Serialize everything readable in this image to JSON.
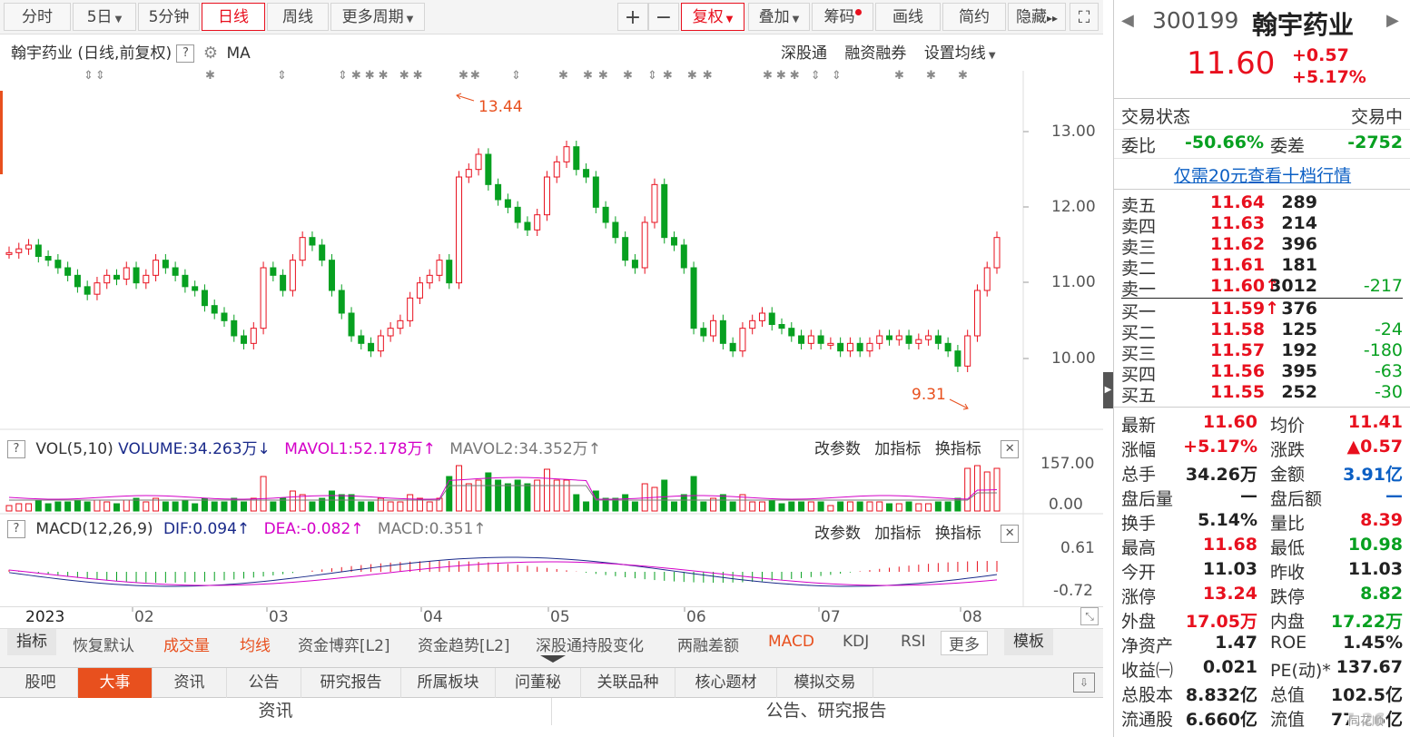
{
  "toolbar": {
    "periods": [
      "分时",
      "5日",
      "5分钟",
      "日线",
      "周线",
      "更多周期"
    ],
    "active_period": "日线",
    "tools": [
      "+",
      "−",
      "复权",
      "叠加",
      "筹码",
      "画线",
      "简约",
      "隐藏"
    ],
    "hide_arrow": "▸▸"
  },
  "main_chart": {
    "title": "翰宇药业 (日线,前复权)",
    "q": "?",
    "ma_label": "MA",
    "links": [
      "深股通",
      "融资融券",
      "设置均线"
    ],
    "y_ticks": [
      "13.00",
      "12.00",
      "11.00",
      "10.00"
    ],
    "high_label": "13.44",
    "low_label": "9.31"
  },
  "vol_panel": {
    "q": "?",
    "name": "VOL(5,10)",
    "volume": "VOLUME:34.263万",
    "volume_arrow": "↓",
    "mavol1": "MAVOL1:52.178万",
    "mavol1_arrow": "↑",
    "mavol2": "MAVOL2:34.352万",
    "mavol2_arrow": "↑",
    "actions": [
      "改参数",
      "加指标",
      "换指标"
    ],
    "close": "✕",
    "y_ticks": [
      "157.00",
      "0.00"
    ]
  },
  "macd_panel": {
    "q": "?",
    "name": "MACD(12,26,9)",
    "dif": "DIF:0.094",
    "dif_arrow": "↑",
    "dea": "DEA:-0.082",
    "dea_arrow": "↑",
    "macd": "MACD:0.351",
    "macd_arrow": "↑",
    "actions": [
      "改参数",
      "加指标",
      "换指标"
    ],
    "close": "✕",
    "y_ticks": [
      "0.61",
      "-0.72"
    ]
  },
  "date_axis": {
    "labels": [
      "2023",
      "02",
      "03",
      "04",
      "05",
      "06",
      "07",
      "08"
    ]
  },
  "indicator_bar": {
    "label": "指标",
    "items": [
      "恢复默认",
      "成交量",
      "均线",
      "资金博弈[L2]",
      "资金趋势[L2]",
      "深股通持股变化",
      "两融差额",
      "MACD",
      "KDJ",
      "RSI"
    ],
    "more": "更多",
    "template": "模板"
  },
  "bottom_tabs": {
    "items": [
      "股吧",
      "大事",
      "资讯",
      "公告",
      "研究报告",
      "所属板块",
      "问董秘",
      "关联品种",
      "核心题材",
      "模拟交易"
    ],
    "active": "大事"
  },
  "news_headers": [
    "资讯",
    "公告、研究报告"
  ],
  "quote": {
    "code": "300199",
    "name": "翰宇药业",
    "price": "11.60",
    "change": "+0.57",
    "change_pct": "+5.17%",
    "status_label": "交易状态",
    "status_value": "交易中",
    "weibi_label": "委比",
    "weibi": "-50.66%",
    "weicha_label": "委差",
    "weicha": "-2752",
    "promo": "仅需20元查看十档行情",
    "asks": [
      {
        "label": "卖五",
        "price": "11.64",
        "vol": "289",
        "chg": ""
      },
      {
        "label": "卖四",
        "price": "11.63",
        "vol": "214",
        "chg": ""
      },
      {
        "label": "卖三",
        "price": "11.62",
        "vol": "396",
        "chg": ""
      },
      {
        "label": "卖二",
        "price": "11.61",
        "vol": "181",
        "chg": ""
      },
      {
        "label": "卖一",
        "price": "11.60↑",
        "vol": "3012",
        "chg": "-217"
      }
    ],
    "bids": [
      {
        "label": "买一",
        "price": "11.59↑",
        "vol": "376",
        "chg": ""
      },
      {
        "label": "买二",
        "price": "11.58",
        "vol": "125",
        "chg": "-24"
      },
      {
        "label": "买三",
        "price": "11.57",
        "vol": "192",
        "chg": "-180"
      },
      {
        "label": "买四",
        "price": "11.56",
        "vol": "395",
        "chg": "-63"
      },
      {
        "label": "买五",
        "price": "11.55",
        "vol": "252",
        "chg": "-30"
      }
    ],
    "stats": [
      {
        "l1": "最新",
        "v1": "11.60",
        "c1": "red",
        "l2": "均价",
        "v2": "11.41",
        "c2": "red"
      },
      {
        "l1": "涨幅",
        "v1": "+5.17%",
        "c1": "red",
        "l2": "涨跌",
        "v2": "▲0.57",
        "c2": "red"
      },
      {
        "l1": "总手",
        "v1": "34.26万",
        "c1": "dark",
        "l2": "金额",
        "v2": "3.91亿",
        "c2": "blue"
      },
      {
        "l1": "盘后量",
        "v1": "—",
        "c1": "dark",
        "l2": "盘后额",
        "v2": "—",
        "c2": "blue"
      },
      {
        "l1": "换手",
        "v1": "5.14%",
        "c1": "dark",
        "l2": "量比",
        "v2": "8.39",
        "c2": "red"
      },
      {
        "l1": "最高",
        "v1": "11.68",
        "c1": "red",
        "l2": "最低",
        "v2": "10.98",
        "c2": "green"
      },
      {
        "l1": "今开",
        "v1": "11.03",
        "c1": "dark",
        "l2": "昨收",
        "v2": "11.03",
        "c2": "dark"
      },
      {
        "l1": "涨停",
        "v1": "13.24",
        "c1": "red",
        "l2": "跌停",
        "v2": "8.82",
        "c2": "green"
      },
      {
        "l1": "外盘",
        "v1": "17.05万",
        "c1": "red",
        "l2": "内盘",
        "v2": "17.22万",
        "c2": "green"
      },
      {
        "l1": "净资产",
        "v1": "1.47",
        "c1": "dark",
        "l2": "ROE",
        "v2": "1.45%",
        "c2": "dark"
      },
      {
        "l1": "收益㈠",
        "v1": "0.021",
        "c1": "dark",
        "l2": "PE(动)*",
        "v2": "137.67",
        "c2": "dark"
      },
      {
        "l1": "总股本",
        "v1": "8.832亿",
        "c1": "dark",
        "l2": "总值",
        "v2": "102.5亿",
        "c2": "dark"
      },
      {
        "l1": "流通股",
        "v1": "6.660亿",
        "c1": "dark",
        "l2": "流值",
        "v2": "77.26亿",
        "c2": "dark"
      }
    ],
    "watermark": "同花顺"
  },
  "colors": {
    "up": "#e8101e",
    "down": "#07a020",
    "accent": "#e8501e",
    "ma_mag": "#d400c8",
    "link_blue": "#0b5fc4"
  }
}
